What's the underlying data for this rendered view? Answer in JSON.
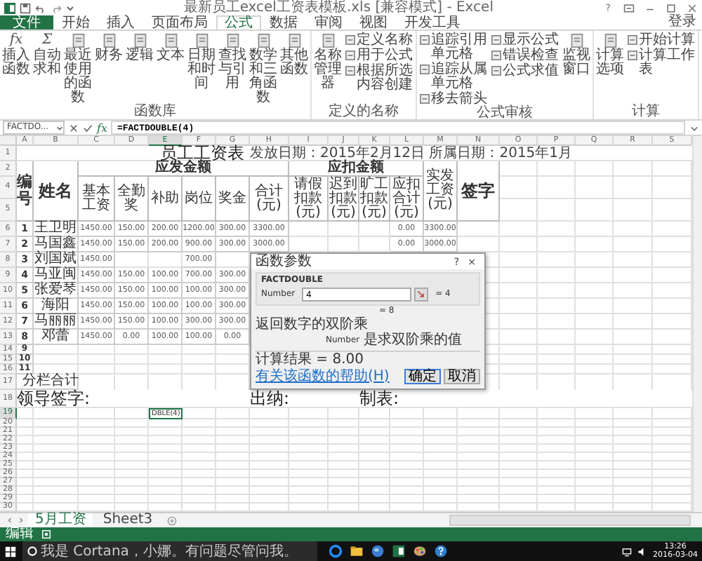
{
  "title_bar": {
    "title": "最新员工excel工资表模板.xls [兼容模式] - Excel",
    "help": "?"
  },
  "tabs": [
    {
      "label": "文件",
      "kind": "file",
      "selected": false
    },
    {
      "label": "开始",
      "kind": "tab",
      "selected": false
    },
    {
      "label": "插入",
      "kind": "tab",
      "selected": false
    },
    {
      "label": "页面布局",
      "kind": "tab",
      "selected": false
    },
    {
      "label": "公式",
      "kind": "tab",
      "selected": true
    },
    {
      "label": "数据",
      "kind": "tab",
      "selected": false
    },
    {
      "label": "审阅",
      "kind": "tab",
      "selected": false
    },
    {
      "label": "视图",
      "kind": "tab",
      "selected": false
    },
    {
      "label": "开发工具",
      "kind": "tab",
      "selected": false
    }
  ],
  "account": "登录",
  "ribbon": [
    {
      "label": "函数库",
      "items": [
        {
          "label": "插入函数",
          "kind": "large",
          "glyph": "fx"
        },
        {
          "label": "自动求和",
          "kind": "large",
          "glyph": "Σ"
        },
        {
          "label": "最近使用的函数",
          "kind": "large"
        },
        {
          "label": "财务",
          "kind": "large"
        },
        {
          "label": "逻辑",
          "kind": "large"
        },
        {
          "label": "文本",
          "kind": "large"
        },
        {
          "label": "日期和时间",
          "kind": "large"
        },
        {
          "label": "查找与引用",
          "kind": "large"
        },
        {
          "label": "数学和三角函数",
          "kind": "large"
        },
        {
          "label": "其他函数",
          "kind": "large"
        }
      ]
    },
    {
      "label": "定义的名称",
      "items": [
        {
          "label": "名称管理器",
          "kind": "large"
        },
        {
          "label": "定义名称",
          "kind": "small"
        },
        {
          "label": "用于公式",
          "kind": "small"
        },
        {
          "label": "根据所选内容创建",
          "kind": "small"
        }
      ]
    },
    {
      "label": "公式审核",
      "items": [
        {
          "label": "追踪引用单元格",
          "kind": "small"
        },
        {
          "label": "追踪从属单元格",
          "kind": "small"
        },
        {
          "label": "移去箭头",
          "kind": "small"
        },
        {
          "label": "显示公式",
          "kind": "small"
        },
        {
          "label": "错误检查",
          "kind": "small"
        },
        {
          "label": "公式求值",
          "kind": "small"
        },
        {
          "label": "监视窗口",
          "kind": "large"
        }
      ]
    },
    {
      "label": "计算",
      "items": [
        {
          "label": "计算选项",
          "kind": "large"
        },
        {
          "label": "开始计算",
          "kind": "small"
        },
        {
          "label": "计算工作表",
          "kind": "small"
        }
      ]
    }
  ],
  "formula_bar": {
    "name_box": "FACTDO...",
    "function_glyph": "fx",
    "formula": "=FACTDOUBLE(4)"
  },
  "sheet": {
    "columns": [
      {
        "label": "A",
        "selected": false
      },
      {
        "label": "B",
        "selected": false
      },
      {
        "label": "C",
        "selected": false
      },
      {
        "label": "D",
        "selected": false
      },
      {
        "label": "E",
        "selected": true
      },
      {
        "label": "F",
        "selected": false
      },
      {
        "label": "G",
        "selected": false
      },
      {
        "label": "H",
        "selected": false
      },
      {
        "label": "I",
        "selected": false
      },
      {
        "label": "J",
        "selected": false
      },
      {
        "label": "K",
        "selected": false
      },
      {
        "label": "L",
        "selected": false
      },
      {
        "label": "M",
        "selected": false
      },
      {
        "label": "N",
        "selected": false
      },
      {
        "label": "O",
        "selected": false
      },
      {
        "label": "P",
        "selected": false
      },
      {
        "label": "Q",
        "selected": false
      },
      {
        "label": "R",
        "selected": false
      },
      {
        "label": "S",
        "selected": false
      }
    ],
    "rows": [
      {
        "label": "1",
        "selected": false
      },
      {
        "label": "2",
        "selected": false
      },
      {
        "label": "4",
        "selected": false
      },
      {
        "label": "5",
        "selected": false
      },
      {
        "label": "6",
        "selected": false
      },
      {
        "label": "7",
        "selected": false
      },
      {
        "label": "8",
        "selected": false
      },
      {
        "label": "9",
        "selected": false
      },
      {
        "label": "10",
        "selected": false
      },
      {
        "label": "11",
        "selected": false
      },
      {
        "label": "12",
        "selected": false
      },
      {
        "label": "13",
        "selected": false
      },
      {
        "label": "14",
        "selected": false
      },
      {
        "label": "15",
        "selected": false
      },
      {
        "label": "16",
        "selected": false
      },
      {
        "label": "17",
        "selected": false
      },
      {
        "label": "18",
        "selected": false
      },
      {
        "label": "19",
        "selected": true
      },
      {
        "label": "20",
        "selected": false
      },
      {
        "label": "21",
        "selected": false
      },
      {
        "label": "22",
        "selected": false
      },
      {
        "label": "23",
        "selected": false
      },
      {
        "label": "24",
        "selected": false
      },
      {
        "label": "25",
        "selected": false
      },
      {
        "label": "26",
        "selected": false
      },
      {
        "label": "27",
        "selected": false
      },
      {
        "label": "28",
        "selected": false
      },
      {
        "label": "29",
        "selected": false
      },
      {
        "label": "30",
        "selected": false
      }
    ],
    "title": "员工工资表",
    "date_line": "发放日期：2015年2月12日 所属日期：2015年1月",
    "header": {
      "no": "编号",
      "name": "姓名",
      "gross_group": "应发金额",
      "gross": [
        "基本工资",
        "全勤奖",
        "补助",
        "岗位",
        "奖金",
        "合计(元)"
      ],
      "deduction_group": "应扣金额",
      "deductions": [
        "请假扣款(元)",
        "迟到扣款(元)",
        "旷工扣款(元)",
        "应扣合计(元)"
      ],
      "net": "实发工资(元)",
      "sign": "签字"
    },
    "employees": [
      {
        "no": "1",
        "name": "王卫明",
        "base": "1450.00",
        "attendance": "150.00",
        "subsidy": "200.00",
        "post": "1200.00",
        "bonus": "300.00",
        "total": "3300.00",
        "deduction_total": "0.00",
        "net": "3300.00"
      },
      {
        "no": "2",
        "name": "马国鑫",
        "base": "1450.00",
        "attendance": "150.00",
        "subsidy": "200.00",
        "post": "900.00",
        "bonus": "300.00",
        "total": "3000.00",
        "deduction_total": "0.00",
        "net": "3000.00"
      },
      {
        "no": "3",
        "name": "刘国斌",
        "base": "1450.00",
        "post": "700.00"
      },
      {
        "no": "4",
        "name": "马亚闽",
        "base": "1450.00",
        "attendance": "150.00",
        "subsidy": "100.00",
        "post": "700.00",
        "bonus": "300.00"
      },
      {
        "no": "5",
        "name": "张爱琴",
        "base": "1450.00",
        "attendance": "150.00",
        "subsidy": "100.00",
        "post": "100.00",
        "bonus": "300.00"
      },
      {
        "no": "6",
        "name": "海阳",
        "base": "1450.00",
        "attendance": "150.00",
        "subsidy": "100.00",
        "post": "100.00",
        "bonus": "300.00"
      },
      {
        "no": "7",
        "name": "马丽丽",
        "base": "1450.00",
        "attendance": "150.00",
        "subsidy": "100.00",
        "post": "300.00",
        "bonus": "300.00"
      },
      {
        "no": "8",
        "name": "邓蕾",
        "base": "1450.00",
        "attendance": "0.00",
        "subsidy": "100.00",
        "post": "100.00",
        "bonus": "0.00"
      }
    ],
    "blank_numbers": [
      "9",
      "10",
      "11"
    ],
    "subtotal": "分栏合计",
    "signatures": [
      "领导签字:",
      "出纳:",
      "制表:"
    ],
    "active_cell": "DBLE(4)"
  },
  "dialog": {
    "title": "函数参数",
    "help": "?",
    "close": "×",
    "function": "FACTDOUBLE",
    "argument": "Number",
    "value": "4",
    "argument_value": "= 4",
    "preview": "= 8",
    "description": "返回数字的双阶乘",
    "argument_name": "Number",
    "argument_description": "是求双阶乘的值",
    "result": "计算结果 =  8.00",
    "help_link": "有关该函数的帮助(H)",
    "ok": "确定",
    "cancel": "取消"
  },
  "sheet_tabs": [
    {
      "label": "5月工资",
      "selected": true
    },
    {
      "label": "Sheet3",
      "selected": false
    }
  ],
  "status": "编辑",
  "taskbar": {
    "search_placeholder": "我是 Cortana，小娜。有问题尽管问我。",
    "time": "13:26",
    "date": "2016-03-04"
  }
}
